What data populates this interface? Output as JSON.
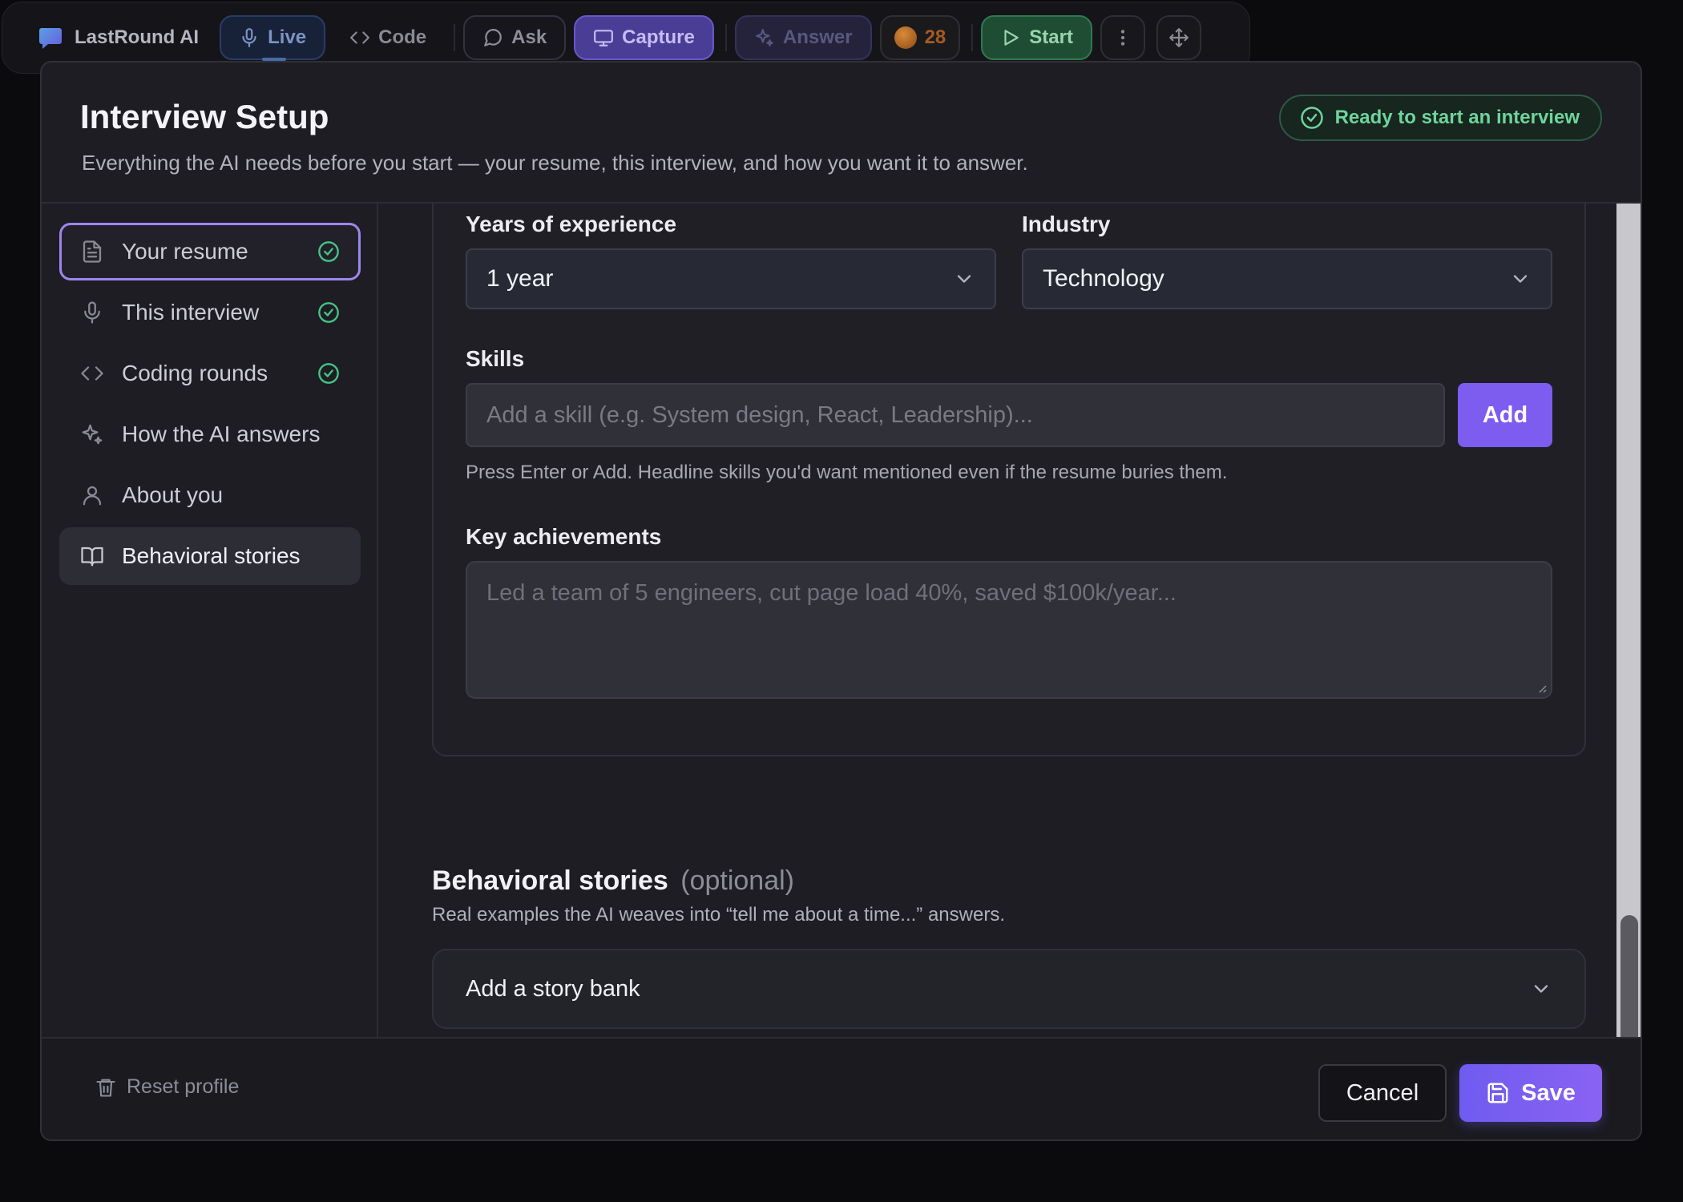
{
  "toolbar": {
    "brand": "LastRound AI",
    "live": "Live",
    "code": "Code",
    "ask": "Ask",
    "capture": "Capture",
    "answer": "Answer",
    "credits": "28",
    "start": "Start",
    "icons": [
      "chat-bubble-logo",
      "mic-icon",
      "code-brackets-icon",
      "message-circle-icon",
      "monitor-icon",
      "sparkles-icon",
      "coin-icon",
      "play-icon",
      "more-vertical-icon",
      "move-icon"
    ]
  },
  "modal": {
    "title": "Interview Setup",
    "subtitle": "Everything the AI needs before you start — your resume, this interview, and how you want it to answer.",
    "status": "Ready to start an interview"
  },
  "sidebar": {
    "items": [
      {
        "label": "Your resume",
        "icon": "file-text-icon",
        "done": true
      },
      {
        "label": "This interview",
        "icon": "mic-icon",
        "done": true
      },
      {
        "label": "Coding rounds",
        "icon": "code-brackets-icon",
        "done": true
      },
      {
        "label": "How the AI answers",
        "icon": "sparkles-icon",
        "done": false
      },
      {
        "label": "About you",
        "icon": "user-icon",
        "done": false
      },
      {
        "label": "Behavioral stories",
        "icon": "book-open-icon",
        "done": false
      }
    ]
  },
  "form": {
    "experience_label": "Years of experience",
    "experience_value": "1 year",
    "industry_label": "Industry",
    "industry_value": "Technology",
    "skills_label": "Skills",
    "skills_placeholder": "Add a skill (e.g. System design, React, Leadership)...",
    "add_label": "Add",
    "skills_helper": "Press Enter or Add. Headline skills you'd want mentioned even if the resume buries them.",
    "achievements_label": "Key achievements",
    "achievements_placeholder": "Led a team of 5 engineers, cut page load 40%, saved $100k/year..."
  },
  "stories": {
    "title": "Behavioral stories",
    "optional": "(optional)",
    "description": "Real examples the AI weaves into “tell me about a time...” answers.",
    "bank": "Add a story bank"
  },
  "footer": {
    "reset": "Reset profile",
    "cancel": "Cancel",
    "save": "Save"
  },
  "colors": {
    "accent": "#7d5cf0",
    "success": "#45c486",
    "background": "#1d1d23"
  }
}
